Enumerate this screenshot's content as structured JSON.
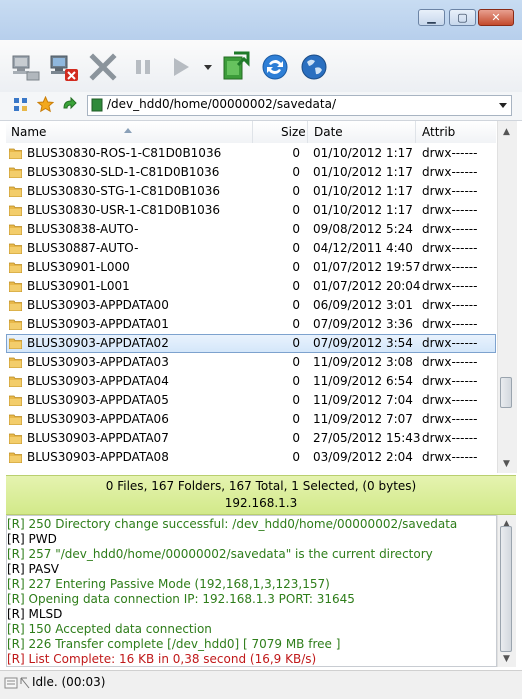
{
  "colors": {
    "folder": "#e8b84a",
    "log_green": "#2e7d1a",
    "log_red": "#c0191a",
    "selection": "#d3e6fa",
    "status_bg": "#dcef9c"
  },
  "toolbar": {
    "buttons": [
      {
        "name": "connect-icon"
      },
      {
        "name": "disconnect-icon"
      },
      {
        "name": "abort-icon"
      },
      {
        "name": "pause-icon"
      },
      {
        "name": "start-queue-icon"
      },
      {
        "name": "dropdown-arrow-icon"
      },
      {
        "name": "refresh-remote-icon"
      },
      {
        "name": "sync-icon"
      },
      {
        "name": "globe-icon"
      }
    ]
  },
  "address": {
    "path": "/dev_hdd0/home/00000002/savedata/"
  },
  "columns": {
    "name": "Name",
    "size": "Size",
    "date": "Date",
    "attrib": "Attrib"
  },
  "files": [
    {
      "name": "BLUS30830-ROS-1-C81D0B1036",
      "size": "0",
      "date": "01/10/2012 1:17",
      "attrib": "drwx------"
    },
    {
      "name": "BLUS30830-SLD-1-C81D0B1036",
      "size": "0",
      "date": "01/10/2012 1:17",
      "attrib": "drwx------"
    },
    {
      "name": "BLUS30830-STG-1-C81D0B1036",
      "size": "0",
      "date": "01/10/2012 1:17",
      "attrib": "drwx------"
    },
    {
      "name": "BLUS30830-USR-1-C81D0B1036",
      "size": "0",
      "date": "01/10/2012 1:17",
      "attrib": "drwx------"
    },
    {
      "name": "BLUS30838-AUTO-",
      "size": "0",
      "date": "09/08/2012 5:24",
      "attrib": "drwx------"
    },
    {
      "name": "BLUS30887-AUTO-",
      "size": "0",
      "date": "04/12/2011 4:40",
      "attrib": "drwx------"
    },
    {
      "name": "BLUS30901-L000",
      "size": "0",
      "date": "01/07/2012 19:57",
      "attrib": "drwx------"
    },
    {
      "name": "BLUS30901-L001",
      "size": "0",
      "date": "01/07/2012 20:04",
      "attrib": "drwx------"
    },
    {
      "name": "BLUS30903-APPDATA00",
      "size": "0",
      "date": "06/09/2012 3:01",
      "attrib": "drwx------"
    },
    {
      "name": "BLUS30903-APPDATA01",
      "size": "0",
      "date": "07/09/2012 3:36",
      "attrib": "drwx------"
    },
    {
      "name": "BLUS30903-APPDATA02",
      "size": "0",
      "date": "07/09/2012 3:54",
      "attrib": "drwx------",
      "selected": true
    },
    {
      "name": "BLUS30903-APPDATA03",
      "size": "0",
      "date": "11/09/2012 3:08",
      "attrib": "drwx------"
    },
    {
      "name": "BLUS30903-APPDATA04",
      "size": "0",
      "date": "11/09/2012 6:54",
      "attrib": "drwx------"
    },
    {
      "name": "BLUS30903-APPDATA05",
      "size": "0",
      "date": "11/09/2012 7:04",
      "attrib": "drwx------"
    },
    {
      "name": "BLUS30903-APPDATA06",
      "size": "0",
      "date": "11/09/2012 7:07",
      "attrib": "drwx------"
    },
    {
      "name": "BLUS30903-APPDATA07",
      "size": "0",
      "date": "27/05/2012 15:43",
      "attrib": "drwx------"
    },
    {
      "name": "BLUS30903-APPDATA08",
      "size": "0",
      "date": "03/09/2012 2:04",
      "attrib": "drwx------"
    }
  ],
  "status": {
    "summary": "0 Files, 167 Folders, 167 Total, 1 Selected, (0 bytes)",
    "host": "192.168.1.3"
  },
  "log": [
    {
      "text": "[R] 250 Directory change successful: /dev_hdd0/home/00000002/savedata",
      "color": "green"
    },
    {
      "text": "[R] PWD",
      "color": "black"
    },
    {
      "text": "[R] 257 \"/dev_hdd0/home/00000002/savedata\" is the current directory",
      "color": "green"
    },
    {
      "text": "[R] PASV",
      "color": "black"
    },
    {
      "text": "[R] 227 Entering Passive Mode (192,168,1,3,123,157)",
      "color": "green"
    },
    {
      "text": "[R] Opening data connection IP: 192.168.1.3 PORT: 31645",
      "color": "green"
    },
    {
      "text": "[R] MLSD",
      "color": "black"
    },
    {
      "text": "[R] 150 Accepted data connection",
      "color": "green"
    },
    {
      "text": "[R] 226 Transfer complete [/dev_hdd0] [ 7079 MB free ]",
      "color": "green"
    },
    {
      "text": "[R] List Complete: 16 KB in 0,38 second (16,9 KB/s)",
      "color": "red"
    }
  ],
  "bottom": {
    "status_text": "Idle. (00:03)"
  }
}
